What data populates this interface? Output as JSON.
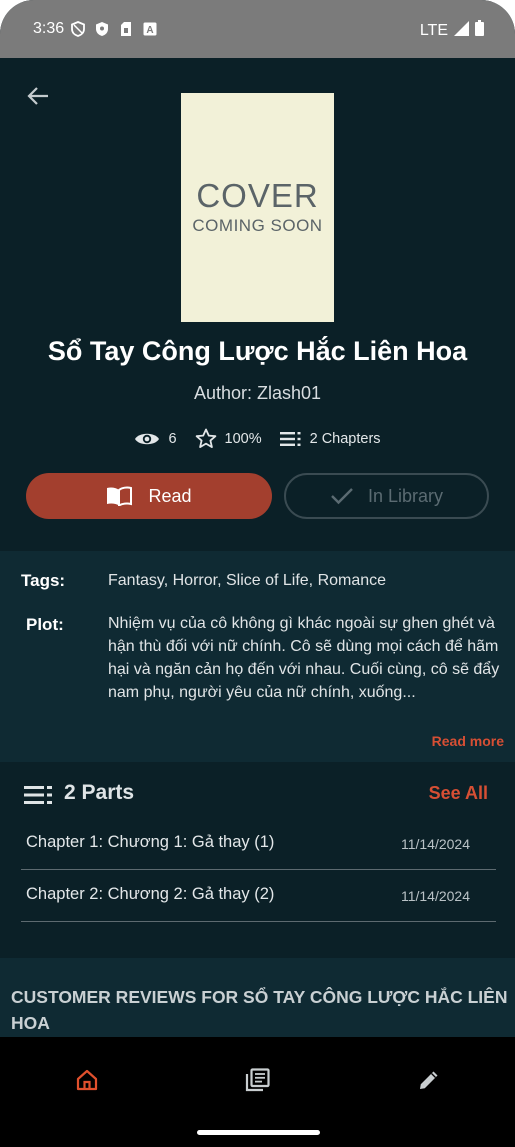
{
  "status_bar": {
    "time": "3:36",
    "network": "LTE"
  },
  "book": {
    "cover_line1": "COVER",
    "cover_line2": "COMING SOON",
    "title": "Sổ Tay Công Lược Hắc Liên Hoa",
    "author": "Author: Zlash01",
    "views": "6",
    "rating": "100%",
    "chapters_count": "2 Chapters"
  },
  "actions": {
    "read_label": "Read",
    "library_label": "In Library"
  },
  "details": {
    "tags_label": "Tags:",
    "tags_value": "Fantasy, Horror, Slice of Life, Romance",
    "plot_label": "Plot:",
    "plot_value": "Nhiệm vụ của cô không gì khác ngoài sự ghen ghét và hận thù đối với nữ chính. Cô sẽ dùng mọi cách để hãm hại và ngăn cản họ đến với nhau. Cuối cùng, cô sẽ đẩy nam phụ, người yêu của nữ chính, xuống...",
    "read_more": "Read more"
  },
  "parts": {
    "title": "2 Parts",
    "see_all": "See All",
    "chapters": [
      {
        "title": "Chapter 1: Chương 1: Gả thay (1)",
        "date": "11/14/2024"
      },
      {
        "title": "Chapter 2: Chương 2: Gả thay (2)",
        "date": "11/14/2024"
      }
    ]
  },
  "reviews": {
    "title": "CUSTOMER REVIEWS FOR SỔ TAY CÔNG LƯỢC HẮC LIÊN HOA"
  },
  "nav": {
    "active": "home",
    "accent": "#e0502d"
  },
  "colors": {
    "background": "#0b2027",
    "panel": "#0f2a33",
    "primary_button": "#a33f2e",
    "accent": "#d64f34",
    "cover": "#f2f1d8"
  }
}
